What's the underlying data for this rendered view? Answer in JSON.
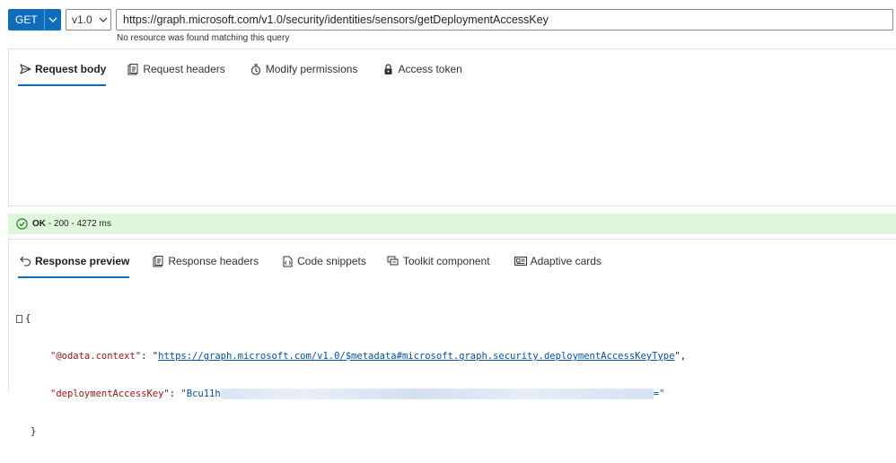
{
  "query_bar": {
    "method": "GET",
    "version": "v1.0",
    "url": "https://graph.microsoft.com/v1.0/security/identities/sensors/getDeploymentAccessKey",
    "hint": "No resource was found matching this query"
  },
  "request_tabs": [
    {
      "label": "Request body",
      "icon": "send-icon",
      "active": true
    },
    {
      "label": "Request headers",
      "icon": "headers-icon",
      "active": false
    },
    {
      "label": "Modify permissions",
      "icon": "permissions-icon",
      "active": false
    },
    {
      "label": "Access token",
      "icon": "lock-icon",
      "active": false
    }
  ],
  "status": {
    "code_text": "OK",
    "detail": "- 200 - 4272 ms",
    "color": "#dff6dd"
  },
  "response_tabs": [
    {
      "label": "Response preview",
      "icon": "undo-icon",
      "active": true
    },
    {
      "label": "Response headers",
      "icon": "headers-icon",
      "active": false
    },
    {
      "label": "Code snippets",
      "icon": "code-icon",
      "active": false
    },
    {
      "label": "Toolkit component",
      "icon": "toolkit-icon",
      "active": false
    },
    {
      "label": "Adaptive cards",
      "icon": "card-icon",
      "active": false
    }
  ],
  "response": {
    "open_brace": "{",
    "close_brace": "}",
    "context_key": "\"@odata.context\"",
    "context_value": "https://graph.microsoft.com/v1.0/$metadata#microsoft.graph.security.deploymentAccessKeyType",
    "key_key": "\"deploymentAccessKey\"",
    "key_value_start": "\"Bcu11h",
    "key_value_end": "=\""
  },
  "colors": {
    "accent": "#0f6cbd",
    "success_bg": "#dff6dd",
    "json_key": "#a31515",
    "json_string": "#0451a5"
  }
}
